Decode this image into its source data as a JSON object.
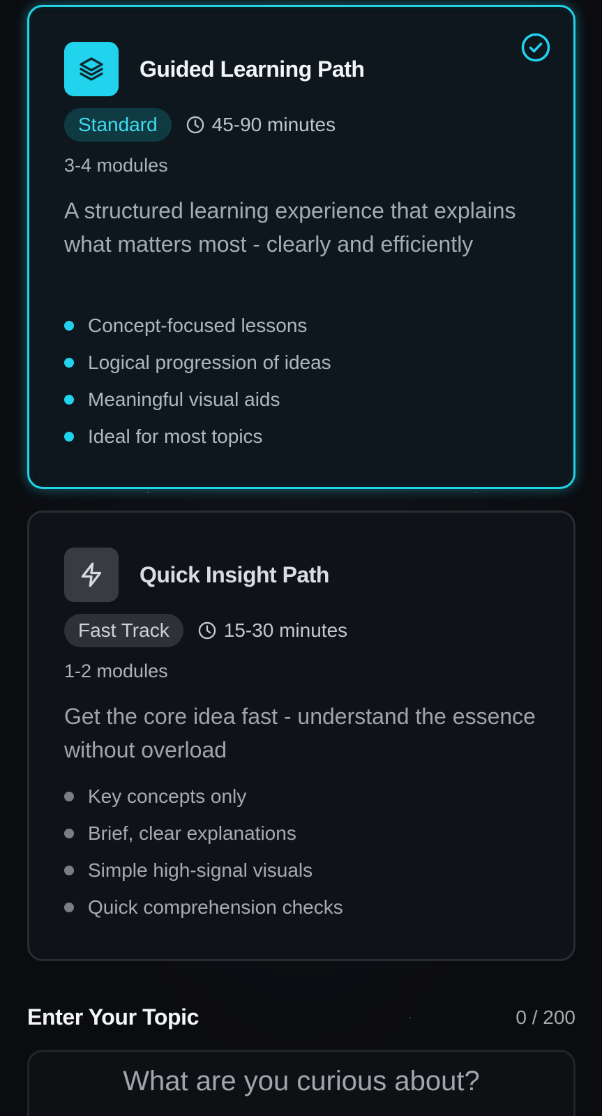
{
  "guided": {
    "title": "Guided Learning Path",
    "badge": "Standard",
    "duration": "45-90 minutes",
    "modules": "3-4 modules",
    "description": "A structured learning experience that explains what matters most - clearly and efficiently",
    "features": [
      "Concept-focused lessons",
      "Logical progression of ideas",
      "Meaningful visual aids",
      "Ideal for most topics"
    ],
    "icon": "layers-icon",
    "selected": true,
    "accent": "#22d3ee"
  },
  "quick": {
    "title": "Quick Insight Path",
    "badge": "Fast Track",
    "duration": "15-30 minutes",
    "modules": "1-2 modules",
    "description": "Get the core idea fast - understand the essence without overload",
    "features": [
      "Key concepts only",
      "Brief, clear explanations",
      "Simple high-signal visuals",
      "Quick comprehension checks"
    ],
    "icon": "lightning-icon",
    "selected": false
  },
  "topic": {
    "label": "Enter Your Topic",
    "count": "0 / 200",
    "placeholder": "What are you curious about?",
    "value": ""
  }
}
